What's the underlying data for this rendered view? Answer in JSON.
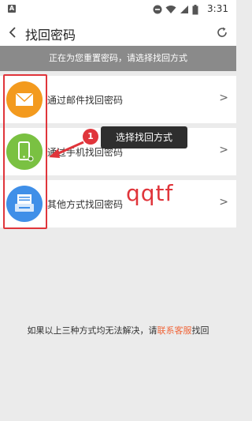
{
  "status_bar": {
    "time": "3:31",
    "app_indicator": "A"
  },
  "header": {
    "title": "找回密码",
    "back_icon": "chevron-left-icon",
    "refresh_icon": "refresh-icon"
  },
  "notice": "正在为您重置密码，请选择找回方式",
  "options": [
    {
      "label": "通过邮件找回密码",
      "icon": "mail-icon",
      "color": "#f39a1e"
    },
    {
      "label": "通过手机找回密码",
      "icon": "phone-icon",
      "color": "#7ac142"
    },
    {
      "label": "其他方式找回密码",
      "icon": "printer-icon",
      "color": "#3f8fe8"
    }
  ],
  "chevron": ">",
  "annotation": {
    "step": "1",
    "tooltip": "选择找回方式",
    "watermark": "qqtf",
    "accent": "#e0353b"
  },
  "footer": {
    "prefix": "如果以上三种方式均无法解决，请",
    "link": "联系客服",
    "suffix": "找回"
  }
}
